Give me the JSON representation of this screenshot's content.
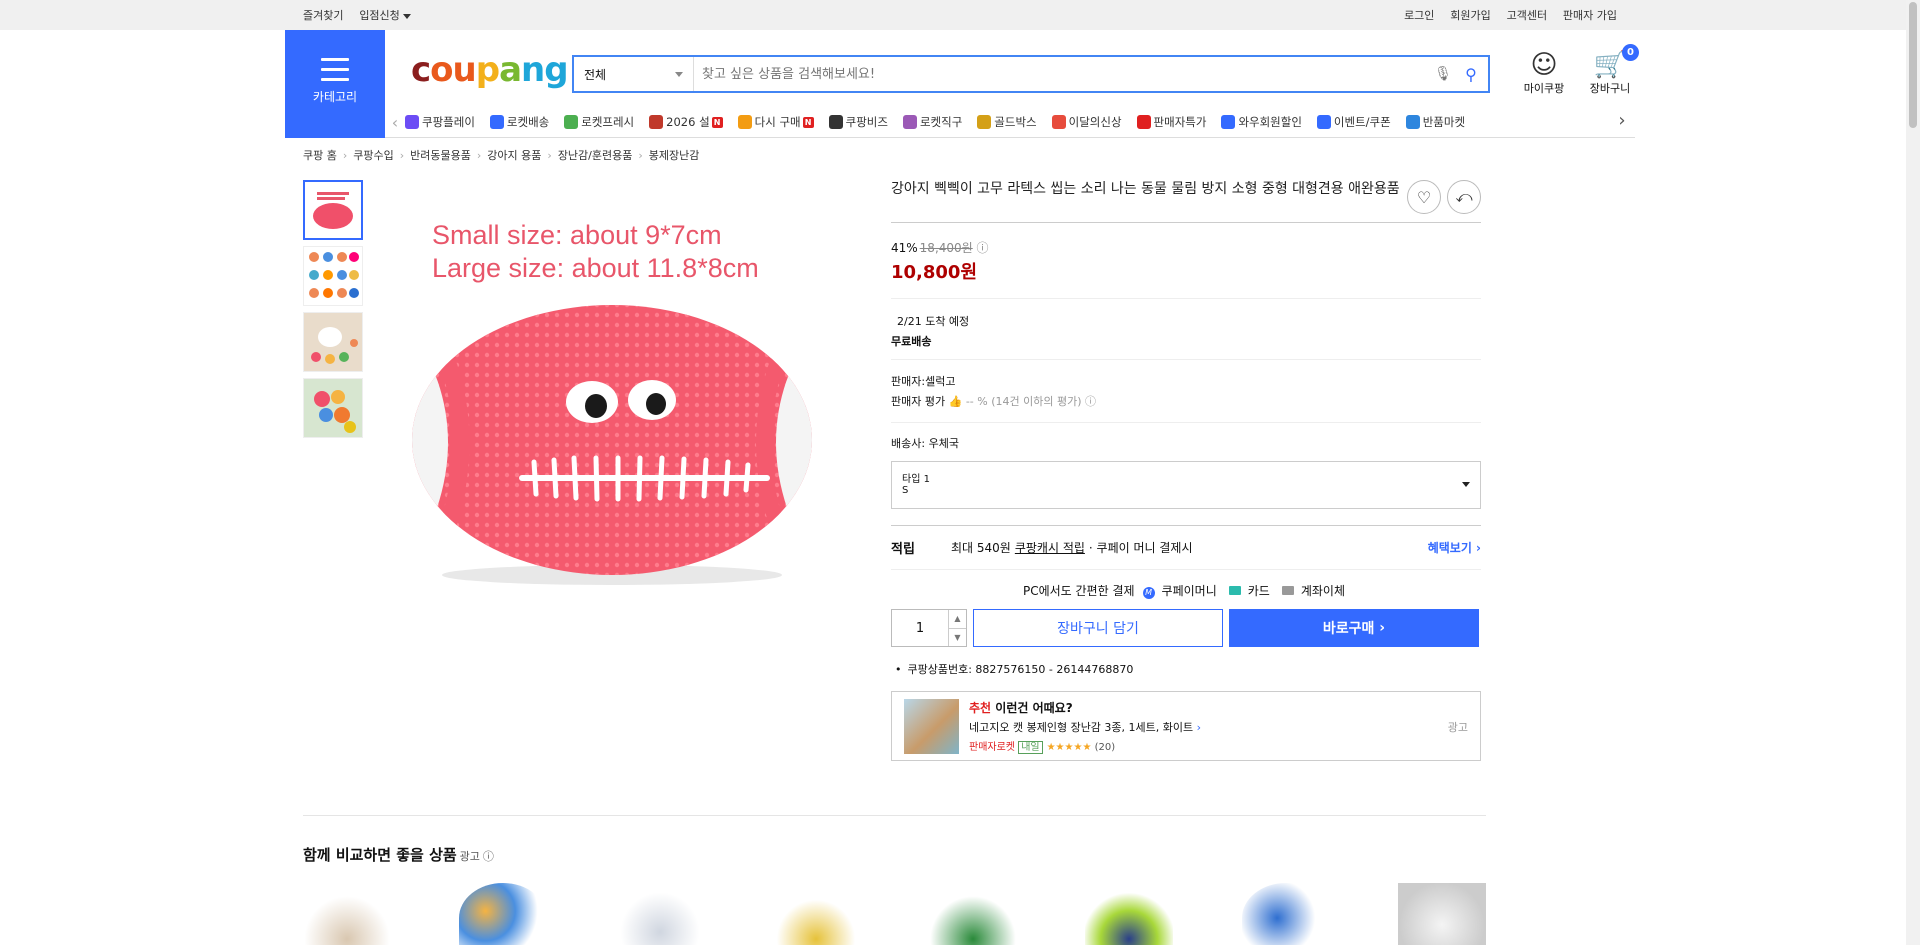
{
  "topbar": {
    "left": [
      "즐겨찾기",
      "입점신청"
    ],
    "right": [
      "로그인",
      "회원가입",
      "고객센터",
      "판매자 가입"
    ]
  },
  "header": {
    "category_label": "카테고리",
    "logo": "coupang",
    "search": {
      "scope": "전체",
      "placeholder": "찾고 싶은 상품을 검색해보세요!"
    },
    "mycoupang": "마이쿠팡",
    "cart": "장바구니",
    "cart_count": "0"
  },
  "nav": {
    "items": [
      {
        "label": "쿠팡플레이",
        "color": "#6c4df5"
      },
      {
        "label": "로켓배송",
        "color": "#346aff"
      },
      {
        "label": "로켓프레시",
        "color": "#4caf50"
      },
      {
        "label": "2026 설",
        "color": "#c0392b",
        "new": true
      },
      {
        "label": "다시 구매",
        "color": "#f39c12",
        "new": true
      },
      {
        "label": "쿠팡비즈",
        "color": "#333333"
      },
      {
        "label": "로켓직구",
        "color": "#9b59b6"
      },
      {
        "label": "골드박스",
        "color": "#d4a017"
      },
      {
        "label": "이달의신상",
        "color": "#e74c3c"
      },
      {
        "label": "판매자특가",
        "color": "#e02020"
      },
      {
        "label": "와우회원할인",
        "color": "#346aff"
      },
      {
        "label": "이벤트/쿠폰",
        "color": "#346aff"
      },
      {
        "label": "반품마켓",
        "color": "#2e86de"
      }
    ],
    "new_badge": "N"
  },
  "breadcrumbs": [
    "쿠팡 홈",
    "쿠팡수입",
    "반려동물용품",
    "강아지 용품",
    "장난감/훈련용품",
    "봉제장난감"
  ],
  "product": {
    "image_text": [
      "Small size: about 9*7cm",
      "Large size: about 11.8*8cm"
    ],
    "title": "강아지 삑삑이 고무 라텍스 씹는 소리 나는 동물 물림 방지 소형 중형 대형견용 애완용품",
    "discount_rate": "41%",
    "original_price": "18,400원",
    "final_price": "10,800원",
    "arrival": "2/21 도착 예정",
    "shipping": "무료배송",
    "seller_label": "판매자:",
    "seller": "셀럭고",
    "seller_rating_label": "판매자 평가",
    "seller_rating": "-- % (14건 이하의 평가)",
    "courier_label": "배송사:",
    "courier": "우체국",
    "option_label": "타입 1",
    "option_value": "S",
    "points_label": "적립",
    "points_text": "최대 540원",
    "points_link": "쿠팡캐시 적립",
    "points_tail": "· 쿠페이 머니 결제시",
    "benefits": "혜택보기",
    "pay_title": "PC에서도 간편한 결제",
    "pay_methods": [
      "쿠페이머니",
      "카드",
      "계좌이체"
    ],
    "quantity": "1",
    "add_to_cart": "장바구니 담기",
    "buy_now": "바로구매",
    "product_number": "쿠팡상품번호: 8827576150 - 26144768870"
  },
  "recommend": {
    "tag": "추천",
    "title": "이런건 어때요?",
    "name": "네고지오 캣 봉제인형 장난감 3종, 1세트, 화이트",
    "badge": "판매자로켓",
    "tomorrow": "내일",
    "stars": "★★★★★",
    "reviews": "(20)",
    "ad": "광고"
  },
  "compare": {
    "title": "함께 비교하면 좋을 상품",
    "ad": "광고"
  }
}
